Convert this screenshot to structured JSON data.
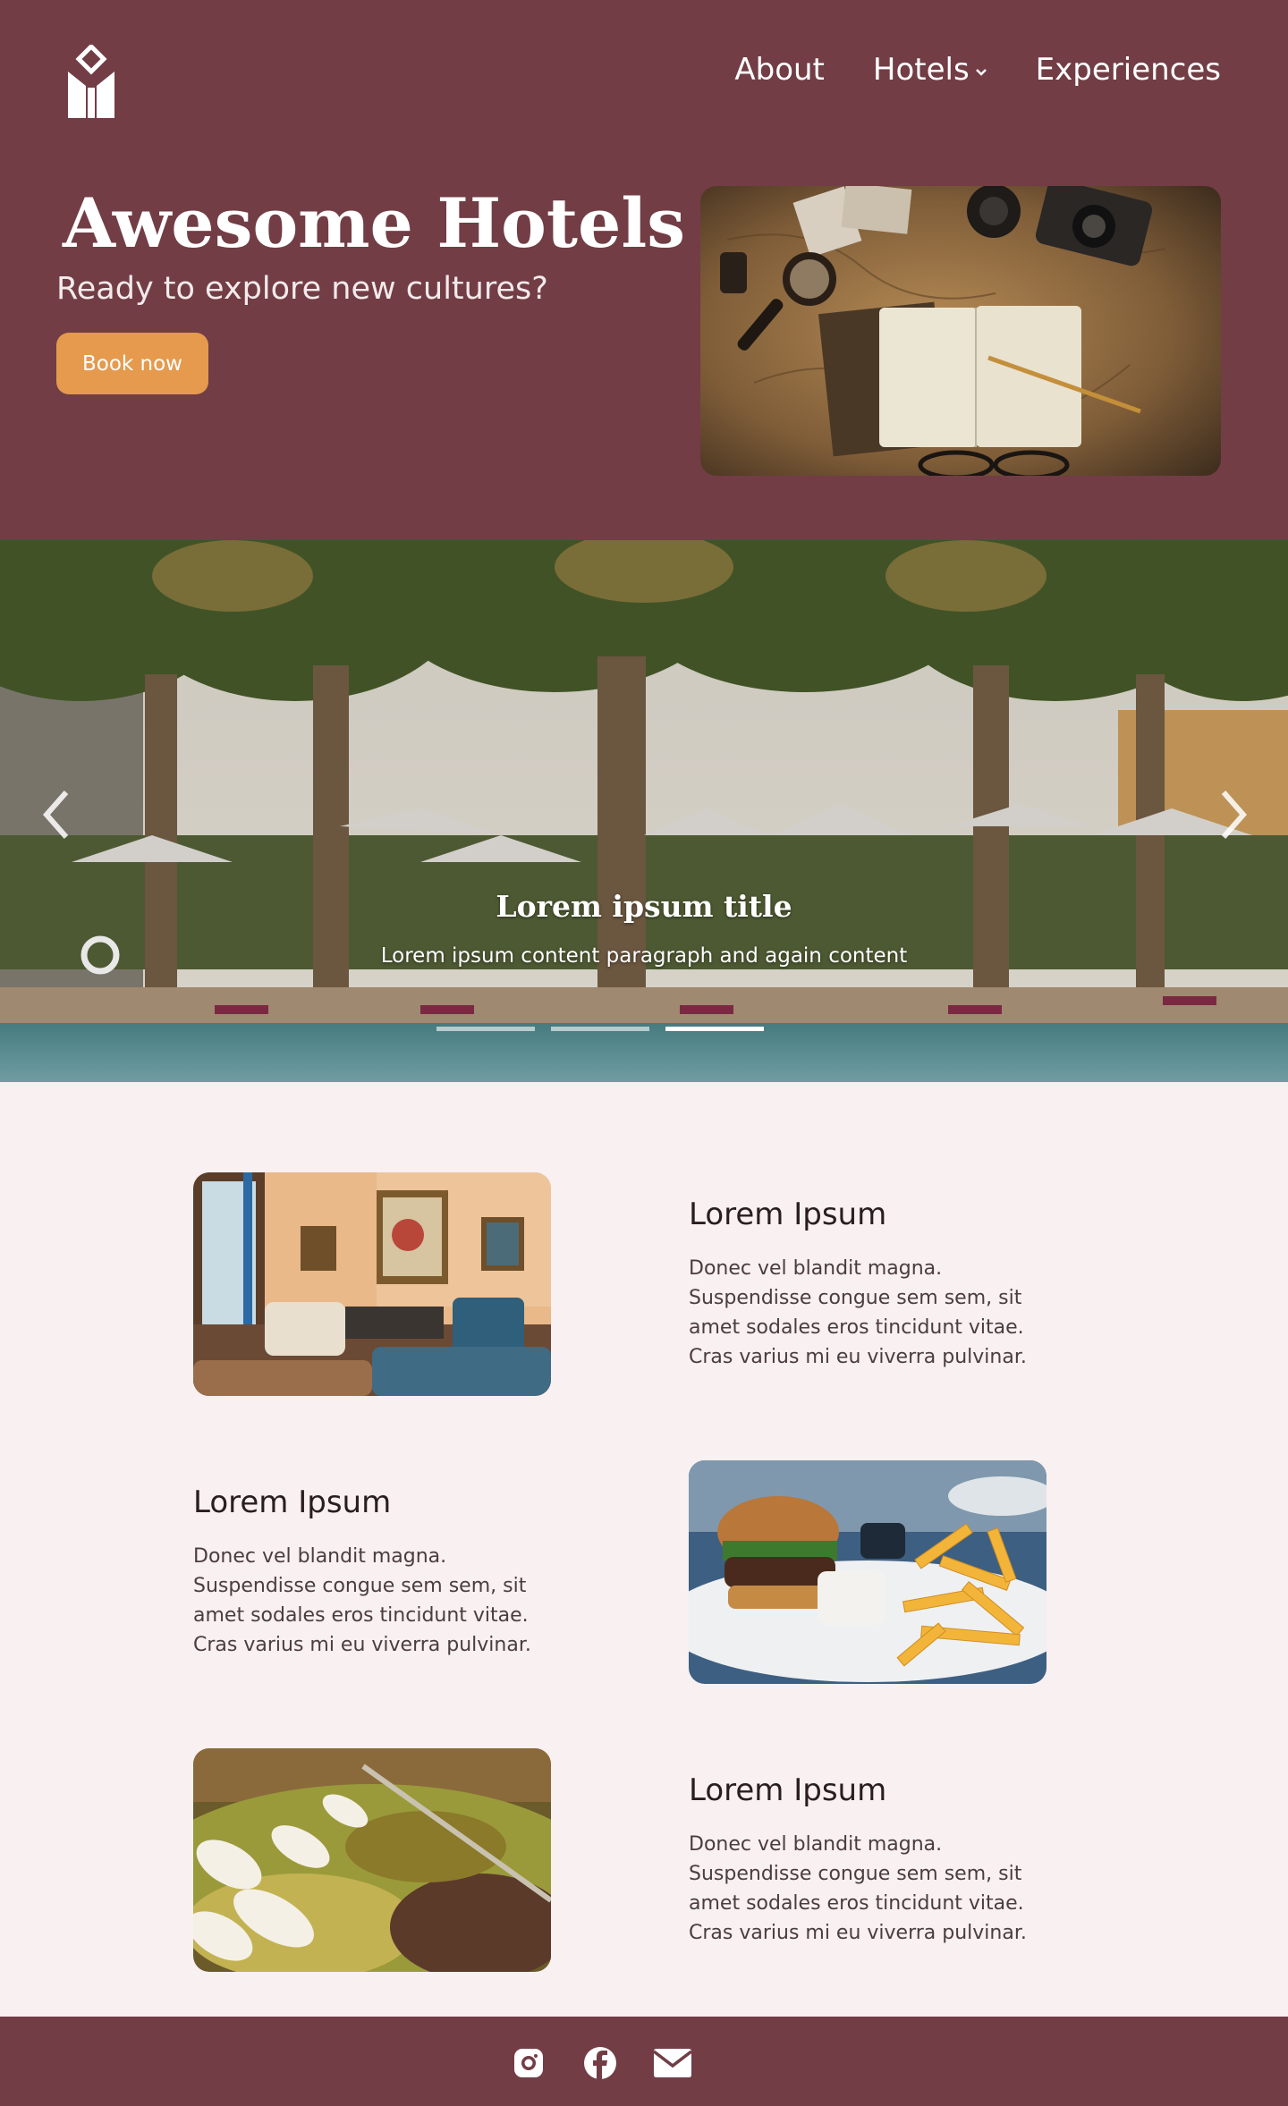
{
  "brand": {
    "logo_icon": "hotel-building-logo"
  },
  "nav": {
    "items": [
      {
        "label": "About"
      },
      {
        "label": "Hotels",
        "has_dropdown": true
      },
      {
        "label": "Experiences"
      }
    ]
  },
  "hero": {
    "title": "Awesome Hotels",
    "subtitle": "Ready to explore new cultures?",
    "cta_label": "Book now",
    "image": "travel-map-notebook-camera-photo"
  },
  "carousel": {
    "slide_title": "Lorem ipsum title",
    "slide_text": "Lorem ipsum content paragraph and again content",
    "image": "resort-pool-palm-trees-photo",
    "slide_count": 3,
    "active_index": 2
  },
  "features": [
    {
      "heading": "Lorem Ipsum",
      "body": "Donec vel blandit magna. Suspendisse congue sem sem, sit amet sodales eros tincidunt vitae. Cras varius mi eu viverra pulvinar.",
      "image": "hotel-lounge-photo"
    },
    {
      "heading": "Lorem Ipsum",
      "body": "Donec vel blandit magna. Suspendisse congue sem sem, sit amet sodales eros tincidunt vitae. Cras varius mi eu viverra pulvinar.",
      "image": "burger-and-fries-photo"
    },
    {
      "heading": "Lorem Ipsum",
      "body": "Donec vel blandit magna. Suspendisse congue sem sem, sit amet sodales eros tincidunt vitae. Cras varius mi eu viverra pulvinar.",
      "image": "olives-market-photo"
    }
  ],
  "footer": {
    "social_icons": [
      "instagram-icon",
      "facebook-icon",
      "mail-icon"
    ]
  },
  "colors": {
    "primary": "#723d45",
    "accent": "#e59a4d",
    "background": "#f8f0f1"
  }
}
